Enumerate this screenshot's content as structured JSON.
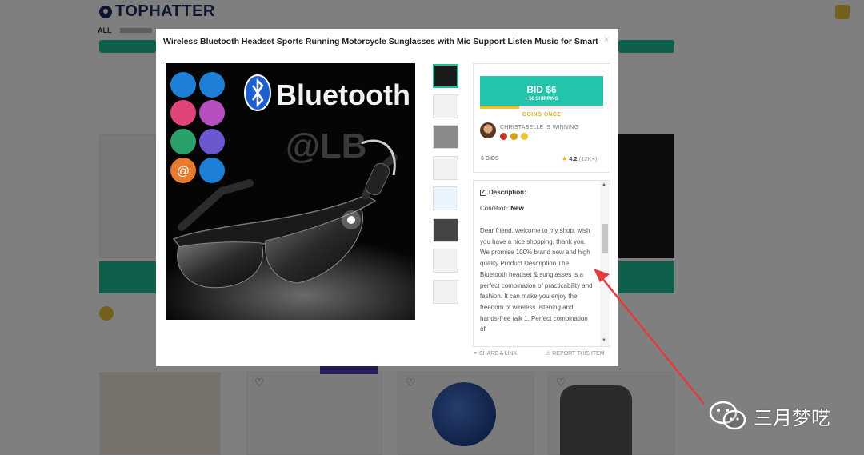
{
  "background": {
    "logo": "TOPHATTER",
    "nav_first": "ALL"
  },
  "modal": {
    "title": "Wireless Bluetooth Headset Sports Running Motorcycle Sunglasses with Mic Support Listen Music for Smart",
    "close": "×",
    "image_brand_text": "Bluetooth",
    "image_watermark": "@LB",
    "bid_label": "BID $6",
    "bid_shipping": "+ $6 SHIPPING",
    "bid_progress": 0.32,
    "auction_status": "GOING ONCE",
    "winner_text": "CHRISTABELLE IS WINNING",
    "bids": "6 BIDS",
    "rating_value": "4.2",
    "rating_count": "(12K+)",
    "description_heading": "Description:",
    "condition_label": "Condition:",
    "condition_value": "New",
    "description_text": "Dear friend, welcome to my shop, wish you have a nice shopping, thank you. We promise 100% brand new and high quality Product Description  The Bluetooth headset & sunglasses is a perfect combination of practicability and fashion. It can make you enjoy the freedom of wireless listening and hands-free talk   1. Perfect combination of",
    "share_link": "SHARE A LINK",
    "report_link": "REPORT THIS ITEM"
  },
  "watermark": {
    "text": "三月梦呓"
  },
  "colors": {
    "accent": "#22c4ab",
    "going": "#e8c63a",
    "arrow": "#e23c3c"
  }
}
